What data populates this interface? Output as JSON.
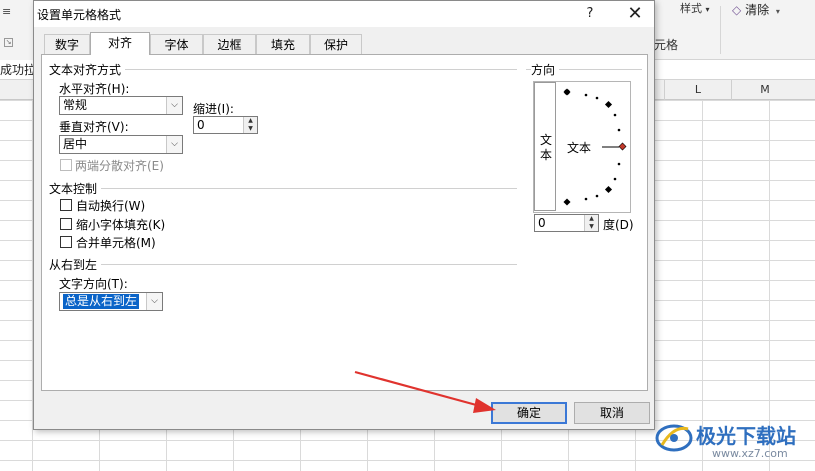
{
  "background": {
    "ribbon_style_label": "样式",
    "ribbon_clear_label": "清除",
    "ribbon_group_label": "元格",
    "formula_text": "成功拉",
    "column_headers": [
      "L",
      "M"
    ]
  },
  "dialog": {
    "title": "设置单元格格式",
    "help": "?",
    "close": "✕",
    "tabs": [
      "数字",
      "对齐",
      "字体",
      "边框",
      "填充",
      "保护"
    ],
    "active_tab": "对齐",
    "alignment": {
      "group_label": "文本对齐方式",
      "horizontal_label": "水平对齐(H):",
      "horizontal_value": "常规",
      "indent_label": "缩进(I):",
      "indent_value": "0",
      "vertical_label": "垂直对齐(V):",
      "vertical_value": "居中",
      "distributed_label": "两端分散对齐(E)"
    },
    "text_control": {
      "group_label": "文本控制",
      "wrap_label": "自动换行(W)",
      "shrink_label": "缩小字体填充(K)",
      "merge_label": "合并单元格(M)"
    },
    "rtl": {
      "group_label": "从右到左",
      "direction_label": "文字方向(T):",
      "direction_value": "总是从右到左"
    },
    "orientation": {
      "group_label": "方向",
      "vertical_text": "文本",
      "horizontal_text": "文本",
      "degrees_value": "0",
      "degrees_label": "度(D)"
    },
    "buttons": {
      "ok": "确定",
      "cancel": "取消"
    }
  },
  "watermark": {
    "text": "极光下载站",
    "url": "www.xz7.com"
  },
  "colors": {
    "ok_border": "#3b78d6",
    "selection": "#0a64c8",
    "arrow": "#e0332e",
    "marker": "#c0392b"
  }
}
